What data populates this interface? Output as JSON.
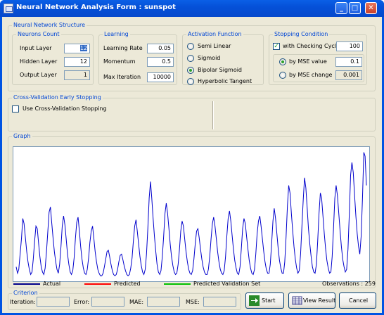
{
  "window": {
    "title": "Neural Network Analysis Form : sunspot",
    "minimize": "_",
    "maximize": "□",
    "close": "✕"
  },
  "structure": {
    "title": "Neural Network Structure",
    "neurons": {
      "title": "Neurons Count",
      "input_label": "Input Layer",
      "input_value": "12",
      "hidden_label": "Hidden Layer",
      "hidden_value": "12",
      "output_label": "Output Layer",
      "output_value": "1"
    },
    "learning": {
      "title": "Learning",
      "rate_label": "Learning Rate",
      "rate_value": "0.05",
      "momentum_label": "Momentum",
      "momentum_value": "0.5",
      "iter_label": "Max Iteration",
      "iter_value": "10000"
    },
    "activation": {
      "title": "Activation Function",
      "options": [
        "Semi Linear",
        "Sigmoid",
        "Bipolar Sigmoid",
        "Hyperbolic Tangent"
      ],
      "selected": "Bipolar Sigmoid"
    },
    "stopping": {
      "title": "Stopping Condition",
      "cycle_label": "with Checking Cycle",
      "cycle_checked": true,
      "cycle_value": "100",
      "mse_label": "by MSE value",
      "mse_value": "0.1",
      "change_label": "by MSE change",
      "change_value": "0.001",
      "selected": "by MSE value"
    }
  },
  "crossval": {
    "title": "Cross-Validation Early Stopping",
    "checkbox_label": "Use Cross-Validation Stopping",
    "checked": false
  },
  "graph": {
    "title": "Graph",
    "legend": {
      "actual": "Actual",
      "actual_color": "#00008b",
      "predicted": "Predicted",
      "predicted_color": "#ff0000",
      "validation": "Predicted Validation Set",
      "validation_color": "#00c000"
    },
    "observations": "Observations : 259"
  },
  "chart_data": {
    "type": "line",
    "series": [
      {
        "name": "Actual",
        "color": "#0000cc",
        "values": [
          0.08,
          0.03,
          0.06,
          0.18,
          0.3,
          0.46,
          0.42,
          0.31,
          0.2,
          0.12,
          0.06,
          0.02,
          0.04,
          0.14,
          0.28,
          0.4,
          0.38,
          0.27,
          0.16,
          0.08,
          0.04,
          0.02,
          0.07,
          0.2,
          0.35,
          0.51,
          0.55,
          0.43,
          0.31,
          0.2,
          0.12,
          0.06,
          0.03,
          0.1,
          0.24,
          0.4,
          0.48,
          0.41,
          0.3,
          0.18,
          0.1,
          0.04,
          0.02,
          0.05,
          0.15,
          0.3,
          0.43,
          0.47,
          0.36,
          0.24,
          0.14,
          0.07,
          0.03,
          0.02,
          0.06,
          0.15,
          0.27,
          0.36,
          0.4,
          0.3,
          0.2,
          0.12,
          0.06,
          0.03,
          0.01,
          0.01,
          0.03,
          0.08,
          0.14,
          0.2,
          0.21,
          0.16,
          0.1,
          0.05,
          0.02,
          0.01,
          0.02,
          0.06,
          0.12,
          0.17,
          0.18,
          0.14,
          0.09,
          0.05,
          0.02,
          0.01,
          0.02,
          0.07,
          0.15,
          0.28,
          0.4,
          0.45,
          0.36,
          0.26,
          0.16,
          0.09,
          0.04,
          0.02,
          0.06,
          0.18,
          0.38,
          0.62,
          0.75,
          0.62,
          0.46,
          0.32,
          0.2,
          0.1,
          0.04,
          0.02,
          0.05,
          0.16,
          0.32,
          0.5,
          0.58,
          0.5,
          0.38,
          0.26,
          0.16,
          0.09,
          0.04,
          0.02,
          0.03,
          0.1,
          0.22,
          0.36,
          0.44,
          0.4,
          0.3,
          0.2,
          0.12,
          0.06,
          0.03,
          0.02,
          0.05,
          0.14,
          0.26,
          0.36,
          0.38,
          0.31,
          0.22,
          0.14,
          0.08,
          0.04,
          0.02,
          0.02,
          0.06,
          0.16,
          0.3,
          0.42,
          0.47,
          0.4,
          0.3,
          0.2,
          0.12,
          0.06,
          0.03,
          0.02,
          0.05,
          0.16,
          0.32,
          0.46,
          0.52,
          0.44,
          0.33,
          0.22,
          0.13,
          0.07,
          0.03,
          0.02,
          0.08,
          0.22,
          0.38,
          0.46,
          0.42,
          0.32,
          0.22,
          0.13,
          0.07,
          0.03,
          0.02,
          0.06,
          0.18,
          0.34,
          0.44,
          0.48,
          0.4,
          0.3,
          0.2,
          0.12,
          0.06,
          0.03,
          0.03,
          0.1,
          0.26,
          0.44,
          0.54,
          0.46,
          0.34,
          0.22,
          0.13,
          0.07,
          0.03,
          0.03,
          0.12,
          0.32,
          0.56,
          0.72,
          0.66,
          0.5,
          0.36,
          0.24,
          0.14,
          0.07,
          0.03,
          0.05,
          0.18,
          0.4,
          0.6,
          0.78,
          0.7,
          0.54,
          0.38,
          0.26,
          0.16,
          0.08,
          0.04,
          0.03,
          0.1,
          0.28,
          0.5,
          0.66,
          0.62,
          0.48,
          0.34,
          0.22,
          0.13,
          0.07,
          0.03,
          0.04,
          0.16,
          0.38,
          0.62,
          0.72,
          0.64,
          0.5,
          0.36,
          0.24,
          0.14,
          0.08,
          0.04,
          0.06,
          0.22,
          0.5,
          0.8,
          0.9,
          0.82,
          0.64,
          0.48,
          0.34,
          0.24,
          0.18,
          0.32,
          0.62,
          0.98,
          0.95,
          0.72
        ]
      }
    ]
  },
  "criterion": {
    "title": "Criterion",
    "iteration_label": "Iteration:",
    "iteration_value": "",
    "error_label": "Error:",
    "error_value": "",
    "mae_label": "MAE:",
    "mae_value": "",
    "mse_label": "MSE:",
    "mse_value": ""
  },
  "buttons": {
    "start": "Start",
    "view": "View Result",
    "cancel": "Cancel"
  }
}
